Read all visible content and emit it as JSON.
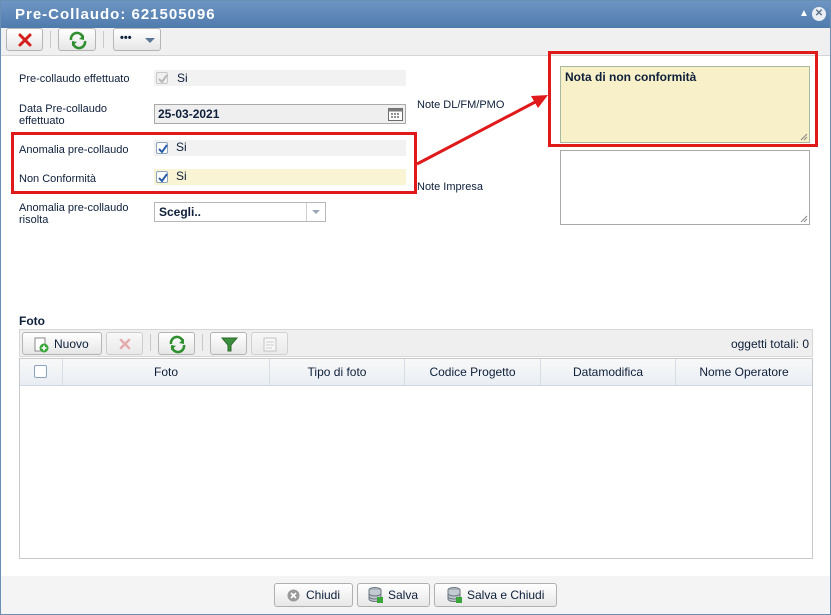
{
  "window": {
    "title": "Pre-Collaudo: 621505096"
  },
  "toolbar": {
    "more_label": "•••"
  },
  "form": {
    "precollaudo_effettuato_label": "Pre-collaudo effettuato",
    "precollaudo_effettuato_value": "Si",
    "data_label_1": "Data Pre-collaudo",
    "data_label_2": "effettuato",
    "data_value": "25-03-2021",
    "anomalia_label": "Anomalia pre-collaudo",
    "anomalia_value": "Si",
    "non_conformita_label": "Non Conformità",
    "non_conformita_value": "Si",
    "anomalia_risolta_label_1": "Anomalia pre-collaudo",
    "anomalia_risolta_label_2": "risolta",
    "anomalia_risolta_value": "Scegli..",
    "note_dl_label": "Note DL/FM/PMO",
    "note_impresa_label": "Note Impresa",
    "note_dl_value": "Nota di non conformità",
    "note_impresa_value": ""
  },
  "foto": {
    "section_title": "Foto",
    "nuovo_label": "Nuovo",
    "total_label": "oggetti totali: 0",
    "columns": [
      "Foto",
      "Tipo di foto",
      "Codice Progetto",
      "Datamodifica",
      "Nome Operatore"
    ]
  },
  "footer": {
    "chiudi_label": "Chiudi",
    "salva_label": "Salva",
    "salva_chiudi_label": "Salva e Chiudi"
  },
  "colors": {
    "highlight": "#e01a1a",
    "titlebar": "#5b86b8",
    "note_bg": "#f7f0c8"
  }
}
